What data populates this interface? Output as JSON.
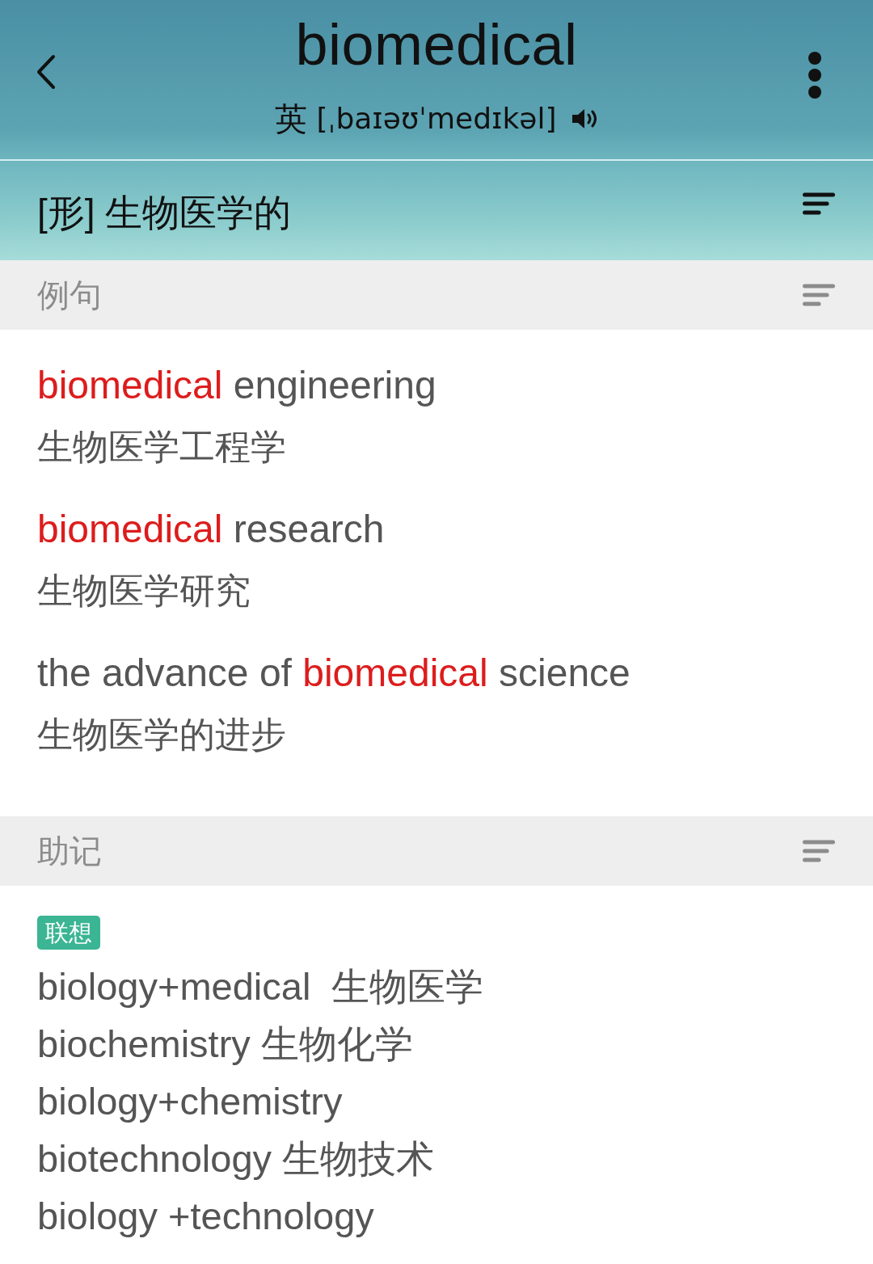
{
  "header": {
    "word": "biomedical",
    "accent": "英",
    "phonetic": "[ˌbaɪəʊˈmedɪkəl]"
  },
  "definition": {
    "text": "[形] 生物医学的"
  },
  "sections": [
    {
      "kind": "examples",
      "title": "例句",
      "examples": [
        {
          "segments": [
            {
              "text": "biomedical",
              "highlight": true
            },
            {
              "text": " engineering",
              "highlight": false
            }
          ],
          "translation": "生物医学工程学"
        },
        {
          "segments": [
            {
              "text": "biomedical",
              "highlight": true
            },
            {
              "text": " research",
              "highlight": false
            }
          ],
          "translation": "生物医学研究"
        },
        {
          "segments": [
            {
              "text": "the advance of ",
              "highlight": false
            },
            {
              "text": "biomedical",
              "highlight": true
            },
            {
              "text": " science",
              "highlight": false
            }
          ],
          "translation": "生物医学的进步"
        }
      ]
    },
    {
      "kind": "mnemonic",
      "title": "助记",
      "tag": "联想",
      "lines": [
        "biology+medical  生物医学",
        "biochemistry 生物化学",
        "biology+chemistry",
        "biotechnology 生物技术",
        "biology +technology"
      ]
    }
  ]
}
